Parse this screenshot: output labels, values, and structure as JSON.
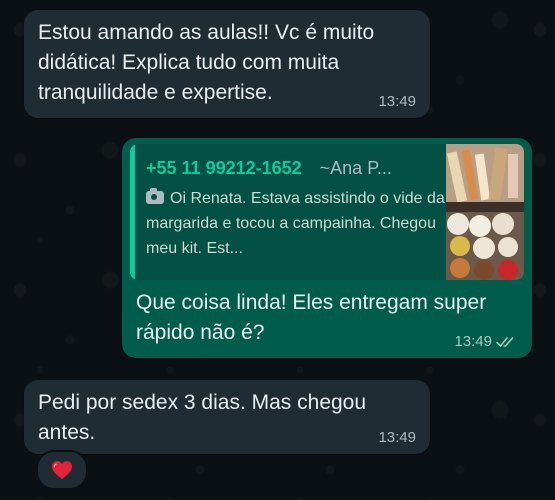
{
  "messages": [
    {
      "direction": "incoming",
      "text": "Estou amando as aulas!! Vc é muito didática! Explica tudo com muita tranquilidade e expertise.",
      "time": "13:49"
    },
    {
      "direction": "outgoing",
      "quote": {
        "sender_phone": "+55 11 99212-1652",
        "sender_name": "~Ana P...",
        "media_icon": "camera-icon",
        "text": "Oi Renata. Estava assistindo o vide da margarida e tocou a campainha.  Chegou meu kit. Est..."
      },
      "text": "Que coisa linda! Eles entregam super rápido não é?",
      "time": "13:49",
      "status_icon": "double-check-icon"
    },
    {
      "direction": "incoming",
      "text": "Pedi por sedex 3 dias. Mas chegou antes.",
      "time": "13:49",
      "reaction_icon": "red-heart-icon"
    }
  ],
  "colors": {
    "background": "#0b1014",
    "incoming_bubble": "#202c33",
    "outgoing_bubble": "#005c4b",
    "quote_accent": "#06cf9c"
  }
}
